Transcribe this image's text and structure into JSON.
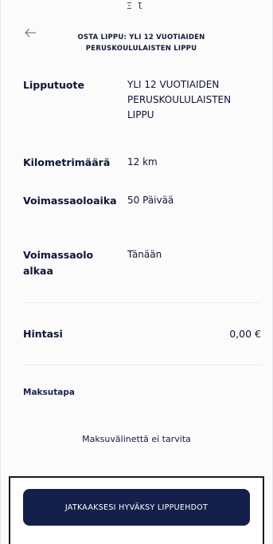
{
  "header": {
    "notch_glyph": "Ξ Ɩ",
    "title_line1": "OSTA LIPPU: YLI 12 VUOTIAIDEN",
    "title_line2": "PERUSKOULULAISTEN LIPPU"
  },
  "details": [
    {
      "label": "Lipputuote",
      "value": "YLI 12 VUOTIAIDEN PERUSKOULULAISTEN LIPPU"
    },
    {
      "label": "Kilometrimäärä",
      "value": "12 km"
    },
    {
      "label": "Voimassaoloaika",
      "value": "50 Päivää"
    },
    {
      "label": "Voimassaolo alkaa",
      "value": "Tänään"
    }
  ],
  "price": {
    "label": "Hintasi",
    "value": "0,00 €"
  },
  "payment": {
    "title": "Maksutapa",
    "text": "Maksuvälinettä ei tarvita"
  },
  "footer": {
    "accept_label": "JATKAAKSESI HYVÄKSY LIPPUEHDOT"
  },
  "colors": {
    "button_bg": "#14204a",
    "text": "#0d1533"
  },
  "icons": {
    "back": "arrow-left-icon"
  }
}
